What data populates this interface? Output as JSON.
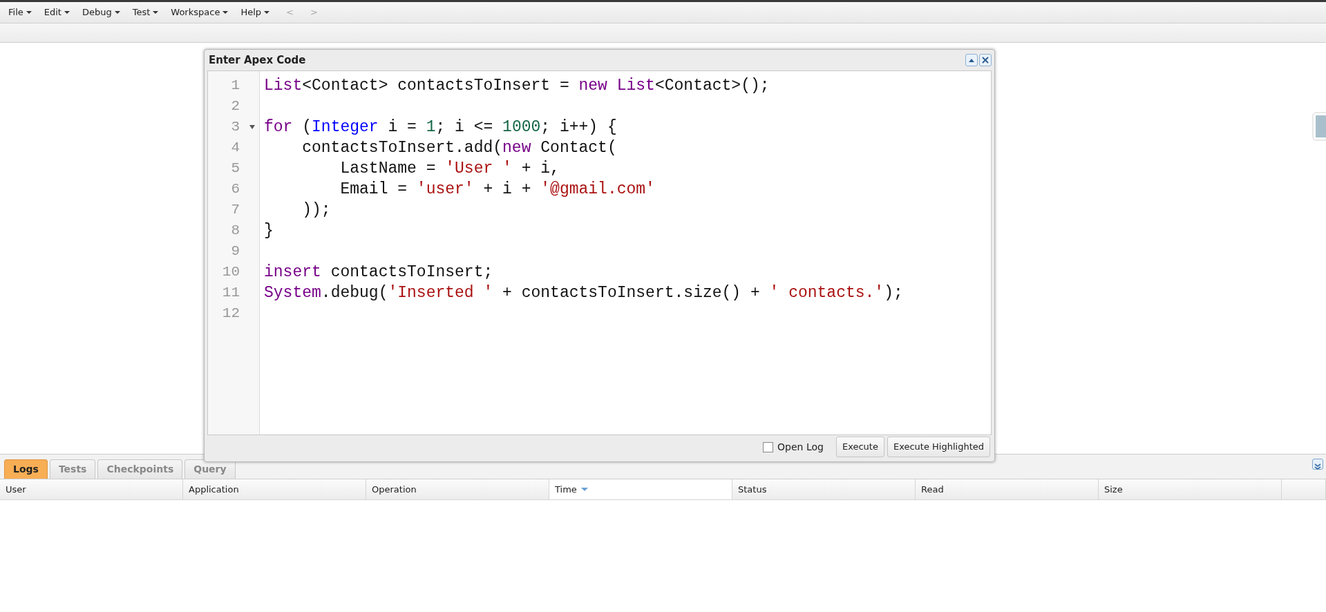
{
  "menu": [
    {
      "label": "File"
    },
    {
      "label": "Edit"
    },
    {
      "label": "Debug"
    },
    {
      "label": "Test"
    },
    {
      "label": "Workspace"
    },
    {
      "label": "Help"
    }
  ],
  "nav": {
    "back": "<",
    "forward": ">"
  },
  "dialog": {
    "title": "Enter Apex Code",
    "lines": [
      {
        "number": "1",
        "foldable": false,
        "tokens": [
          {
            "kind": "keyword",
            "text": "List"
          },
          {
            "kind": "plain",
            "text": "<Contact> contactsToInsert = "
          },
          {
            "kind": "keyword",
            "text": "new "
          },
          {
            "kind": "keyword",
            "text": "List"
          },
          {
            "kind": "plain",
            "text": "<Contact>();"
          }
        ]
      },
      {
        "number": "2",
        "foldable": false
      },
      {
        "number": "3",
        "foldable": true,
        "tokens": [
          {
            "kind": "keyword",
            "text": "for"
          },
          {
            "kind": "plain",
            "text": " ("
          },
          {
            "kind": "type",
            "text": "Integer"
          },
          {
            "kind": "plain",
            "text": " i = "
          },
          {
            "kind": "number",
            "text": "1"
          },
          {
            "kind": "plain",
            "text": "; i <= "
          },
          {
            "kind": "number",
            "text": "1000"
          },
          {
            "kind": "plain",
            "text": "; i++) {"
          }
        ]
      },
      {
        "number": "4",
        "foldable": false,
        "tokens": [
          {
            "kind": "plain",
            "text": "    contactsToInsert.add("
          },
          {
            "kind": "keyword",
            "text": "new"
          },
          {
            "kind": "plain",
            "text": " Contact("
          }
        ]
      },
      {
        "number": "5",
        "foldable": false,
        "tokens": [
          {
            "kind": "plain",
            "text": "        LastName = "
          },
          {
            "kind": "string",
            "text": "'User '"
          },
          {
            "kind": "plain",
            "text": " + i,"
          }
        ]
      },
      {
        "number": "6",
        "foldable": false,
        "tokens": [
          {
            "kind": "plain",
            "text": "        Email = "
          },
          {
            "kind": "string",
            "text": "'user'"
          },
          {
            "kind": "plain",
            "text": " + i + "
          },
          {
            "kind": "string",
            "text": "'@gmail.com'"
          }
        ]
      },
      {
        "number": "7",
        "foldable": false,
        "tokens": [
          {
            "kind": "plain",
            "text": "    ));"
          }
        ]
      },
      {
        "number": "8",
        "foldable": false,
        "tokens": [
          {
            "kind": "plain",
            "text": "}"
          }
        ]
      },
      {
        "number": "9",
        "foldable": false
      },
      {
        "number": "10",
        "foldable": false,
        "tokens": [
          {
            "kind": "keyword",
            "text": "insert"
          },
          {
            "kind": "plain",
            "text": " contactsToInsert;"
          }
        ]
      },
      {
        "number": "11",
        "foldable": false,
        "tokens": [
          {
            "kind": "keyword",
            "text": "System"
          },
          {
            "kind": "plain",
            "text": ".debug("
          },
          {
            "kind": "string",
            "text": "'Inserted '"
          },
          {
            "kind": "plain",
            "text": " + contactsToInsert.size() + "
          },
          {
            "kind": "string",
            "text": "' contacts.'"
          },
          {
            "kind": "plain",
            "text": ");"
          }
        ]
      },
      {
        "number": "12",
        "foldable": false
      }
    ],
    "open_log": {
      "label": "Open Log",
      "checked": false
    },
    "buttons": [
      "Execute",
      "Execute Highlighted"
    ]
  },
  "tabs": [
    {
      "label": "Logs",
      "selected": true
    },
    {
      "label": "Tests",
      "selected": false
    },
    {
      "label": "Checkpoints",
      "selected": false
    },
    {
      "label": "Query",
      "selected": false
    }
  ],
  "table": {
    "columns": [
      {
        "label": "User",
        "sorted": false
      },
      {
        "label": "Application",
        "sorted": false
      },
      {
        "label": "Operation",
        "sorted": false
      },
      {
        "label": "Time",
        "sorted": true
      },
      {
        "label": "Status",
        "sorted": false
      },
      {
        "label": "Read",
        "sorted": false
      },
      {
        "label": "Size",
        "sorted": false
      }
    ]
  }
}
